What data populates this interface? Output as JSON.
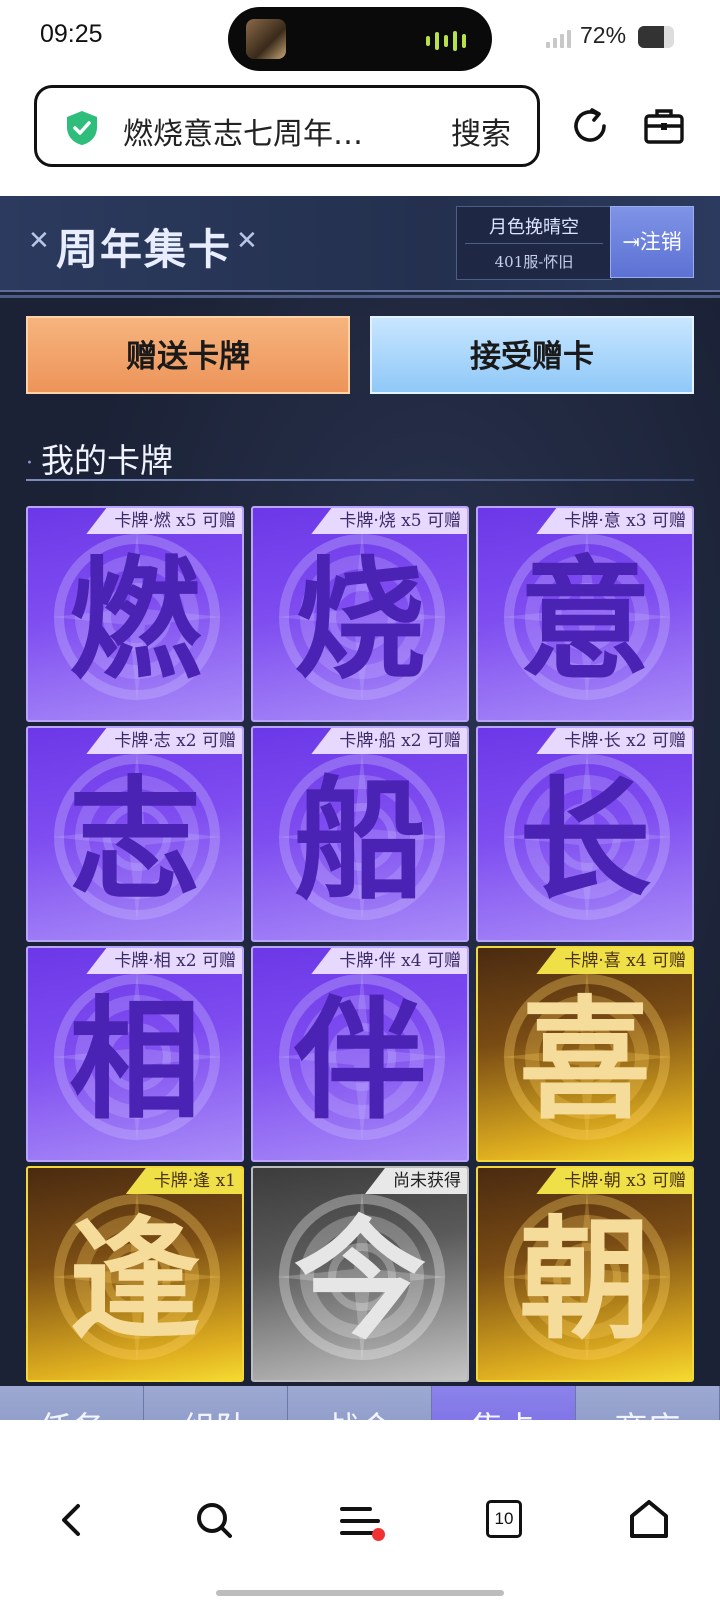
{
  "status_bar": {
    "time": "09:25",
    "battery_text": "72%",
    "battery_level": 0.72
  },
  "browser": {
    "url_text": "燃烧意志七周年…",
    "search_label": "搜索",
    "icons": [
      "shield-check-icon",
      "reload-icon",
      "toolbox-icon"
    ]
  },
  "game": {
    "title": "周年集卡",
    "user": {
      "name": "月色挽晴空",
      "server": "401服-怀旧",
      "logout_label": "注销"
    },
    "buttons": {
      "give": "赠送卡牌",
      "receive": "接受赠卡"
    },
    "section_title": "我的卡牌",
    "cards": [
      {
        "char": "燃",
        "tag": "卡牌·燃 x5 可赠",
        "style": "purple"
      },
      {
        "char": "烧",
        "tag": "卡牌·烧 x5 可赠",
        "style": "purple"
      },
      {
        "char": "意",
        "tag": "卡牌·意 x3 可赠",
        "style": "purple"
      },
      {
        "char": "志",
        "tag": "卡牌·志 x2 可赠",
        "style": "purple"
      },
      {
        "char": "船",
        "tag": "卡牌·船 x2 可赠",
        "style": "purple"
      },
      {
        "char": "长",
        "tag": "卡牌·长 x2 可赠",
        "style": "purple"
      },
      {
        "char": "相",
        "tag": "卡牌·相 x2 可赠",
        "style": "purple"
      },
      {
        "char": "伴",
        "tag": "卡牌·伴 x4 可赠",
        "style": "purple"
      },
      {
        "char": "喜",
        "tag": "卡牌·喜 x4 可赠",
        "style": "gold"
      },
      {
        "char": "逢",
        "tag": "卡牌·逢 x1",
        "style": "gold"
      },
      {
        "char": "今",
        "tag": "尚未获得",
        "style": "gray"
      },
      {
        "char": "朝",
        "tag": "卡牌·朝 x3 可赠",
        "style": "gold"
      }
    ],
    "tabs": [
      {
        "label": "任务",
        "active": false
      },
      {
        "label": "组队",
        "active": false
      },
      {
        "label": "战令",
        "active": false
      },
      {
        "label": "集卡",
        "active": true
      },
      {
        "label": "商店",
        "active": false
      }
    ]
  },
  "bottom_nav": {
    "items": [
      "back-icon",
      "search-icon",
      "menu-icon",
      "tabs-icon",
      "home-icon"
    ],
    "tabs_count": "10"
  }
}
